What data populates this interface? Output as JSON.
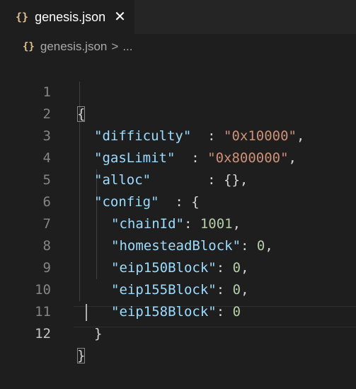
{
  "tab": {
    "icon": "{}",
    "label": "genesis.json",
    "close": "✕"
  },
  "breadcrumb": {
    "icon": "{}",
    "file": "genesis.json",
    "sep": ">",
    "more": "..."
  },
  "line_numbers": [
    "1",
    "2",
    "3",
    "4",
    "5",
    "6",
    "7",
    "8",
    "9",
    "10",
    "11",
    "12"
  ],
  "code": {
    "open_brace": "{",
    "difficulty_key": "\"difficulty\"",
    "difficulty_sep": "  : ",
    "difficulty_val": "\"0x10000\"",
    "gaslimit_key": "\"gasLimit\"",
    "gaslimit_sep": "  : ",
    "gaslimit_val": "\"0x800000\"",
    "alloc_key": "\"alloc\"",
    "alloc_sep": "       : ",
    "alloc_val": "{}",
    "config_key": "\"config\"",
    "config_sep": "  : ",
    "config_open": "{",
    "chainid_key": "\"chainId\"",
    "chainid_val": "1001",
    "homestead_key": "\"homesteadBlock\"",
    "homestead_val": "0",
    "eip150_key": "\"eip150Block\"",
    "eip150_val": "0",
    "eip155_key": "\"eip155Block\"",
    "eip155_val": "0",
    "eip158_key": "\"eip158Block\"",
    "eip158_val": "0",
    "config_close": "}",
    "close_brace": "}",
    "comma": ",",
    "colon_space": ": "
  },
  "colors": {
    "background": "#1e1e1e",
    "key": "#9cdcfe",
    "string": "#ce9178",
    "number": "#b5cea8",
    "json_icon": "#e2c08d"
  }
}
